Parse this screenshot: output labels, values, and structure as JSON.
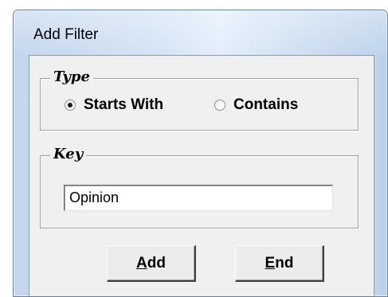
{
  "window": {
    "title": "Add Filter"
  },
  "type_group": {
    "legend": "Type",
    "options": [
      {
        "label": "Starts With",
        "checked": true
      },
      {
        "label": "Contains",
        "checked": false
      }
    ]
  },
  "key_group": {
    "legend": "Key",
    "input_value": "Opinion"
  },
  "buttons": {
    "add": {
      "mnemonic": "A",
      "rest": "dd"
    },
    "end": {
      "mnemonic": "E",
      "rest": "nd"
    }
  }
}
